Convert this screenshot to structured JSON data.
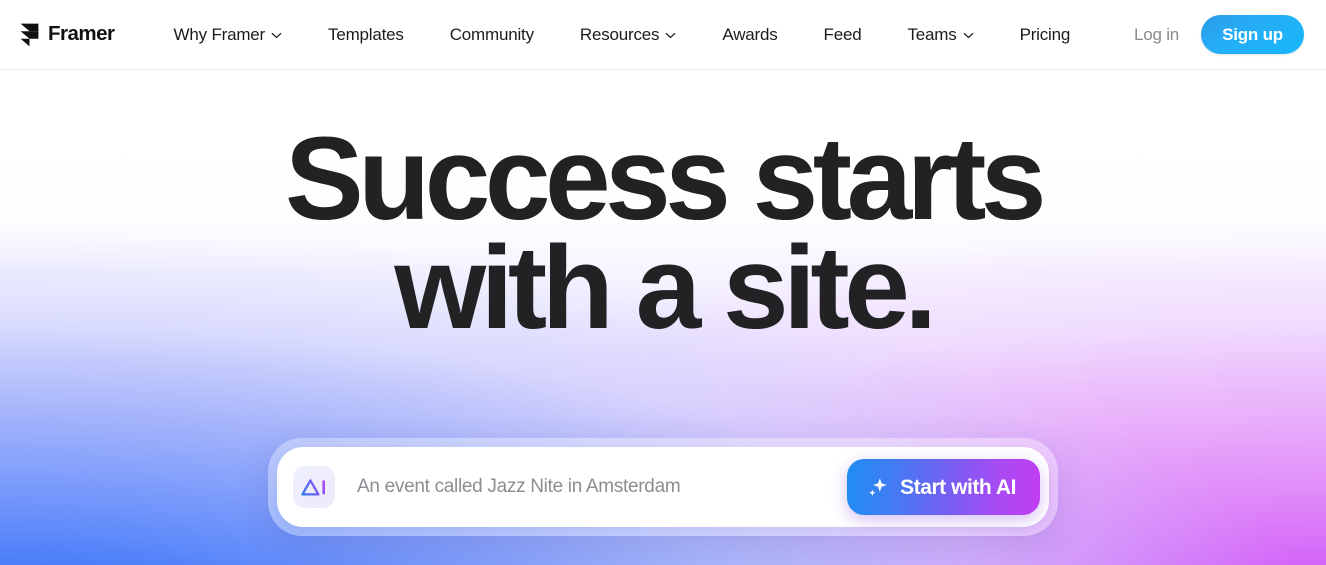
{
  "brand": {
    "name": "Framer",
    "logo_icon": "framer-logo-icon"
  },
  "nav": {
    "links": [
      {
        "label": "Why Framer",
        "has_dropdown": true,
        "icon": "chevron-down-icon"
      },
      {
        "label": "Templates",
        "has_dropdown": false,
        "icon": ""
      },
      {
        "label": "Community",
        "has_dropdown": false,
        "icon": ""
      },
      {
        "label": "Resources",
        "has_dropdown": true,
        "icon": "chevron-down-icon"
      },
      {
        "label": "Awards",
        "has_dropdown": false,
        "icon": ""
      },
      {
        "label": "Feed",
        "has_dropdown": false,
        "icon": ""
      },
      {
        "label": "Teams",
        "has_dropdown": true,
        "icon": "chevron-down-icon"
      },
      {
        "label": "Pricing",
        "has_dropdown": false,
        "icon": ""
      }
    ],
    "login_label": "Log in",
    "signup_label": "Sign up"
  },
  "hero": {
    "headline_line1": "Success starts",
    "headline_line2": "with a site.",
    "headline_color": "#222224"
  },
  "prompt": {
    "ai_badge_icon": "ai-logo-icon",
    "ai_badge_text": "AI",
    "input_value": "",
    "placeholder": "An event called Jazz Nite in Amsterdam",
    "cta_label": "Start with AI",
    "cta_icon": "sparkle-icon"
  },
  "colors": {
    "signup_blue": "#1eb0f7",
    "cta_gradient_start": "#1f8df2",
    "cta_gradient_end": "#c23ef2",
    "hero_left": "#1d62f5",
    "hero_right": "#ca44f7",
    "placeholder_gray": "#8d8d93",
    "login_gray": "#8a8a8e"
  }
}
